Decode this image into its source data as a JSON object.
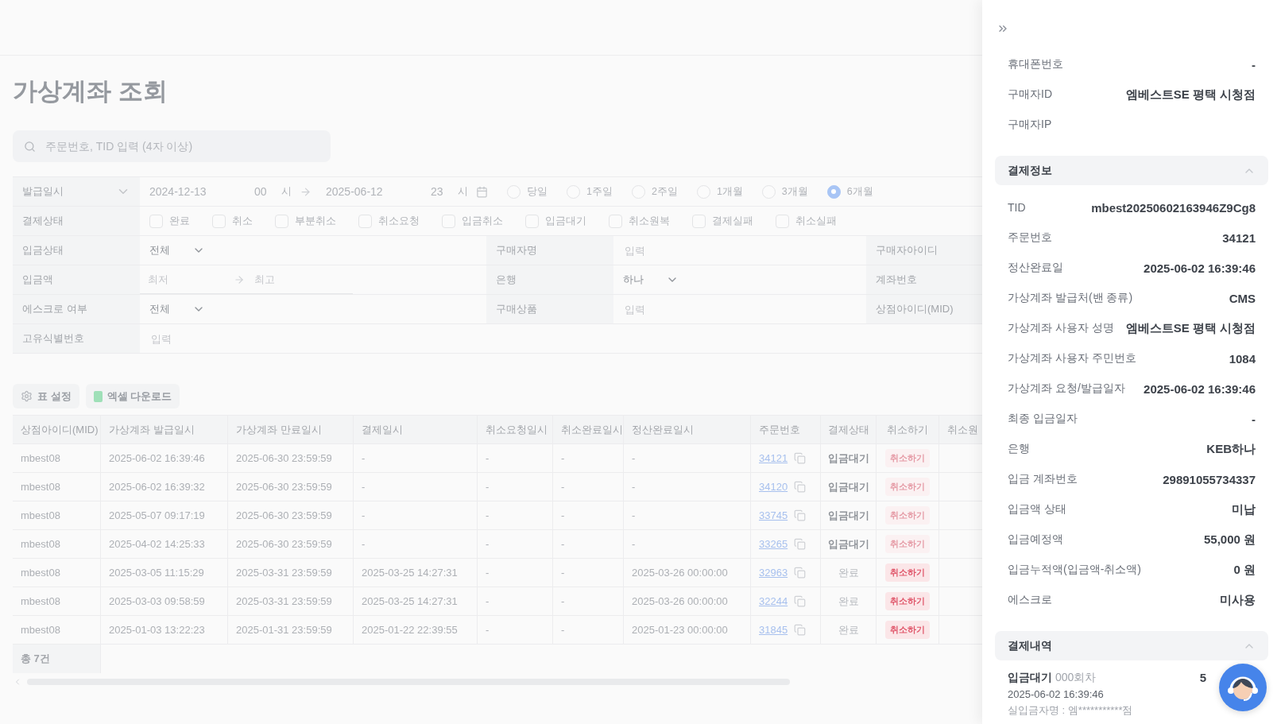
{
  "page": {
    "title": "가상계좌 조회",
    "search": {
      "placeholder": "주문번호, TID 입력 (4자 이상)"
    }
  },
  "date_filter": {
    "label": "발급일시",
    "from": "2024-12-13",
    "from_hour": "00",
    "from_unit": "시",
    "to": "2025-06-12",
    "to_hour": "23",
    "to_unit": "시",
    "ranges": [
      {
        "label": "당일",
        "selected": false
      },
      {
        "label": "1주일",
        "selected": false
      },
      {
        "label": "2주일",
        "selected": false
      },
      {
        "label": "1개월",
        "selected": false
      },
      {
        "label": "3개월",
        "selected": false
      },
      {
        "label": "6개월",
        "selected": true
      }
    ]
  },
  "status_filter": {
    "label": "결제상태",
    "options": [
      {
        "label": "완료",
        "checked": false
      },
      {
        "label": "취소",
        "checked": false
      },
      {
        "label": "부분취소",
        "checked": false
      },
      {
        "label": "취소요청",
        "checked": false
      },
      {
        "label": "입금취소",
        "checked": false
      },
      {
        "label": "입금대기",
        "checked": false
      },
      {
        "label": "취소원복",
        "checked": false
      },
      {
        "label": "결제실패",
        "checked": false
      },
      {
        "label": "취소실패",
        "checked": false
      }
    ]
  },
  "filter_rows": [
    {
      "cells": [
        {
          "kind": "label",
          "text": "입금상태"
        },
        {
          "kind": "select",
          "value": "전체"
        },
        {
          "kind": "label",
          "text": "구매자명"
        },
        {
          "kind": "input",
          "placeholder": "입력"
        },
        {
          "kind": "label",
          "text": "구매자아이디"
        }
      ]
    },
    {
      "cells": [
        {
          "kind": "label",
          "text": "입금액"
        },
        {
          "kind": "range",
          "min_placeholder": "최저",
          "max_placeholder": "최고"
        },
        {
          "kind": "label",
          "text": "은행"
        },
        {
          "kind": "select",
          "value": "하나"
        },
        {
          "kind": "label",
          "text": "계좌번호"
        }
      ]
    },
    {
      "cells": [
        {
          "kind": "label",
          "text": "에스크로 여부"
        },
        {
          "kind": "select",
          "value": "전체"
        },
        {
          "kind": "label",
          "text": "구매상품"
        },
        {
          "kind": "input",
          "placeholder": "입력"
        },
        {
          "kind": "label",
          "text": "상점아이디(MID)"
        }
      ]
    },
    {
      "cells": [
        {
          "kind": "label",
          "text": "고유식별번호"
        },
        {
          "kind": "input",
          "placeholder": "입력"
        }
      ]
    }
  ],
  "toolbar": [
    {
      "kind": "settings",
      "label": "표 설정"
    },
    {
      "kind": "excel",
      "label": "엑셀 다운로드"
    }
  ],
  "table": {
    "columns": [
      "상점아이디(MID)",
      "가상계좌 발급일시",
      "가상계좌 만료일시",
      "결제일시",
      "취소요청일시",
      "취소완료일시",
      "정산완료일시",
      "주문번호",
      "결제상태",
      "취소하기",
      "취소원"
    ],
    "rows": [
      {
        "cells": [
          "mbest08",
          "2025-06-02 16:39:46",
          "2025-06-30 23:59:59",
          "-",
          "-",
          "-",
          "-"
        ],
        "order": "34121",
        "status": "입금대기",
        "kind": "waiting",
        "cancel": {
          "label": "취소하기",
          "disabled": true
        }
      },
      {
        "cells": [
          "mbest08",
          "2025-06-02 16:39:32",
          "2025-06-30 23:59:59",
          "-",
          "-",
          "-",
          "-"
        ],
        "order": "34120",
        "status": "입금대기",
        "kind": "waiting",
        "cancel": {
          "label": "취소하기",
          "disabled": true
        }
      },
      {
        "cells": [
          "mbest08",
          "2025-05-07 09:17:19",
          "2025-06-30 23:59:59",
          "-",
          "-",
          "-",
          "-"
        ],
        "order": "33745",
        "status": "입금대기",
        "kind": "waiting",
        "cancel": {
          "label": "취소하기",
          "disabled": true
        }
      },
      {
        "cells": [
          "mbest08",
          "2025-04-02 14:25:33",
          "2025-06-30 23:59:59",
          "-",
          "-",
          "-",
          "-"
        ],
        "order": "33265",
        "status": "입금대기",
        "kind": "waiting",
        "cancel": {
          "label": "취소하기",
          "disabled": true
        }
      },
      {
        "cells": [
          "mbest08",
          "2025-03-05 11:15:29",
          "2025-03-31 23:59:59",
          "2025-03-25 14:27:31",
          "-",
          "-",
          "2025-03-26 00:00:00"
        ],
        "order": "32963",
        "status": "완료",
        "kind": "done",
        "cancel": {
          "label": "취소하기",
          "disabled": false
        }
      },
      {
        "cells": [
          "mbest08",
          "2025-03-03 09:58:59",
          "2025-03-31 23:59:59",
          "2025-03-25 14:27:31",
          "-",
          "-",
          "2025-03-26 00:00:00"
        ],
        "order": "32244",
        "status": "완료",
        "kind": "done",
        "cancel": {
          "label": "취소하기",
          "disabled": false
        }
      },
      {
        "cells": [
          "mbest08",
          "2025-01-03 13:22:23",
          "2025-01-31 23:59:59",
          "2025-01-22 22:39:55",
          "-",
          "-",
          "2025-01-23 00:00:00"
        ],
        "order": "31845",
        "status": "완료",
        "kind": "done",
        "cancel": {
          "label": "취소하기",
          "disabled": false
        }
      }
    ],
    "footer": "총 7건"
  },
  "drawer": {
    "sections": [
      {
        "rows": [
          {
            "label": "휴대폰번호",
            "value": "-"
          },
          {
            "label": "구매자ID",
            "value": "엠베스트SE 평택 시청점"
          },
          {
            "label": "구매자IP"
          }
        ]
      },
      {
        "title": "결제정보",
        "expanded": true,
        "rows": [
          {
            "label": "TID",
            "value": "mbest20250602163946Z9Cg8"
          },
          {
            "label": "주문번호",
            "value": "34121"
          },
          {
            "label": "정산완료일",
            "value": "2025-06-02 16:39:46"
          },
          {
            "label": "가상계좌 발급처(밴 종류)",
            "value": "CMS"
          },
          {
            "label": "가상계좌 사용자 성명",
            "value": "엠베스트SE 평택 시청점"
          },
          {
            "label": "가상계좌 사용자 주민번호",
            "value": "1084"
          },
          {
            "label": "가상계좌 요청/발급일자",
            "value": "2025-06-02 16:39:46"
          },
          {
            "label": "최종 입금일자",
            "value": "-"
          },
          {
            "label": "은행",
            "value": "KEB하나"
          },
          {
            "label": "입금 계좌번호",
            "value": "29891055734337"
          },
          {
            "label": "입금액 상태",
            "value": "미납"
          },
          {
            "label": "입금예정액",
            "value": "55,000 원"
          },
          {
            "label": "입금누적액(입금액-취소액)",
            "value": "0 원"
          },
          {
            "label": "에스크로",
            "value": "미사용"
          }
        ]
      },
      {
        "title": "결제내역",
        "expanded": true,
        "entries": [
          {
            "status": "입금대기",
            "round": "000회차",
            "amount": "5",
            "date": "2025-06-02 16:39:46",
            "depositor": "실입금자명 : 엠***********점"
          }
        ]
      }
    ]
  }
}
